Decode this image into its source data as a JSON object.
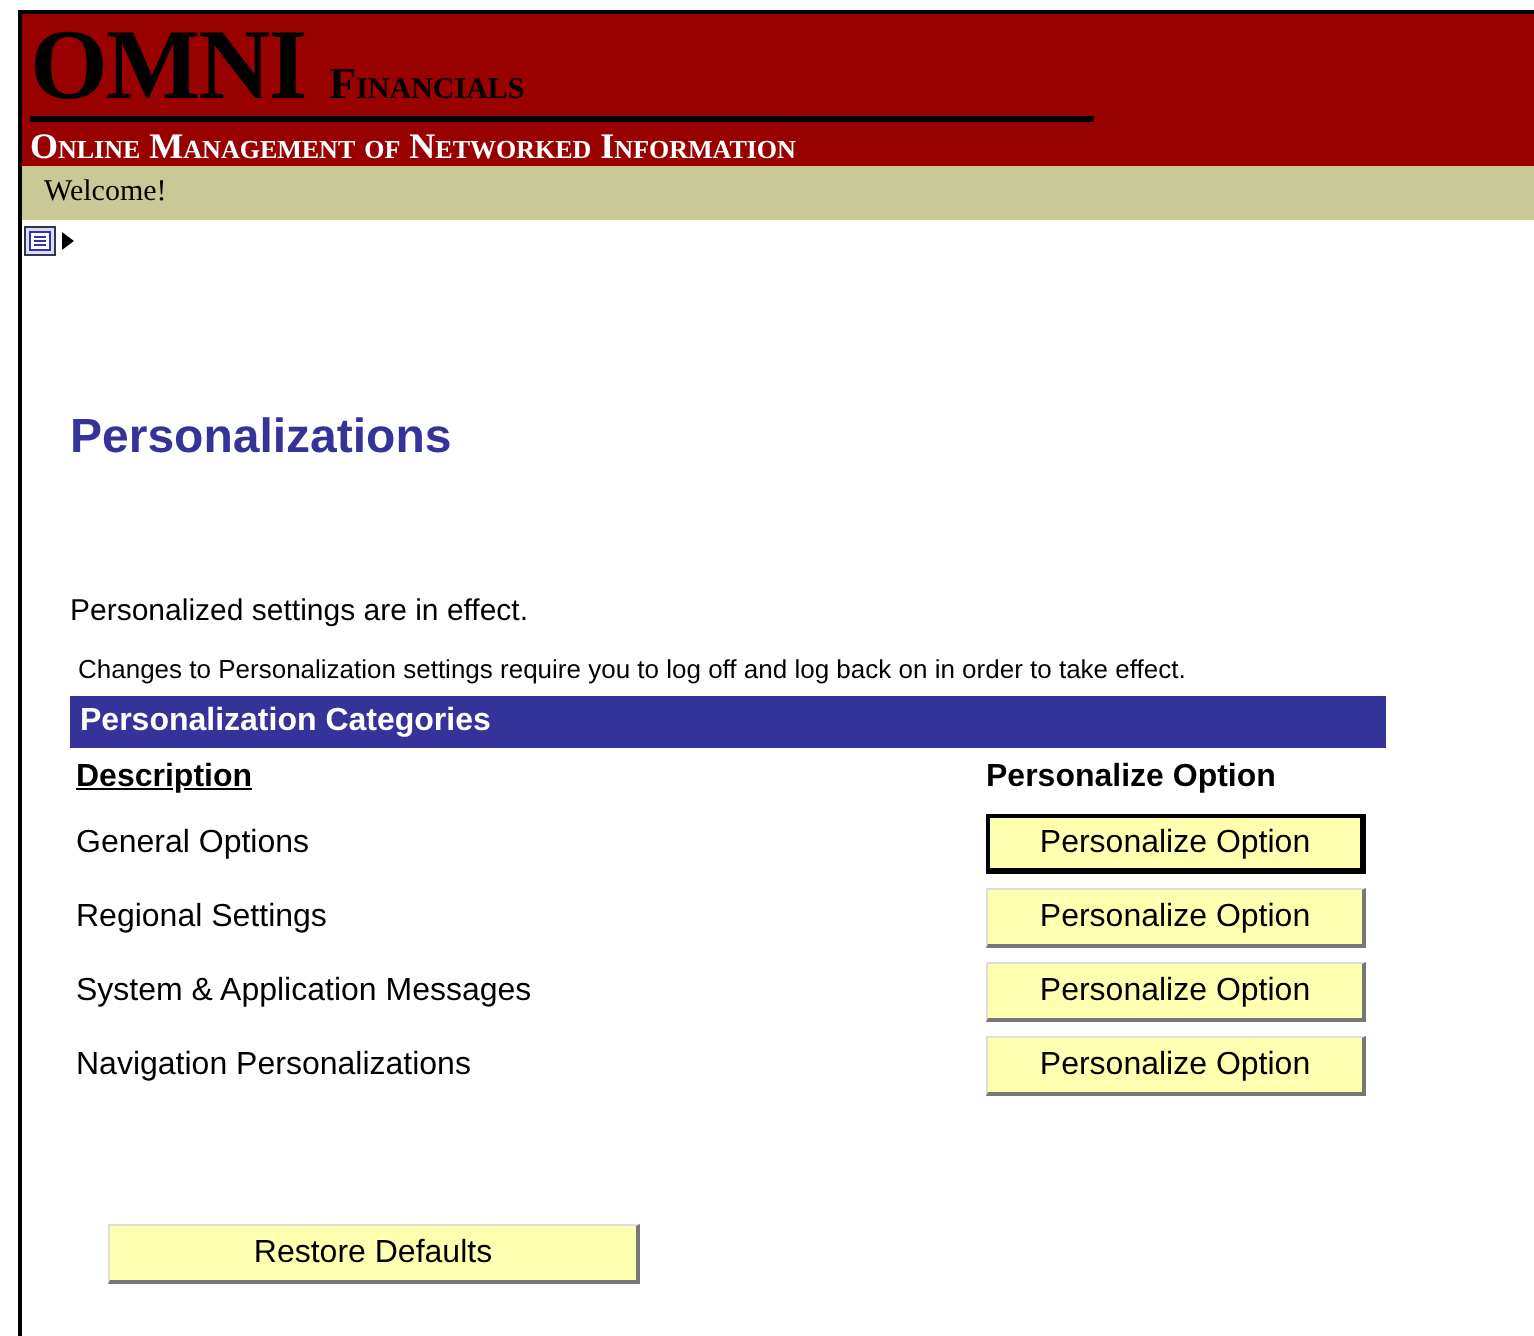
{
  "header": {
    "logo": "OMNI",
    "subtitle": "Financials",
    "tagline": "Online Management of Networked Information"
  },
  "welcome": "Welcome!",
  "page_title": "Personalizations",
  "status_message": "Personalized settings are in effect.",
  "notice": "Changes to Personalization settings require you to log off and log back on in order to take effect.",
  "table": {
    "title": "Personalization Categories",
    "columns": [
      "Description",
      "Personalize Option"
    ],
    "rows": [
      {
        "description": "General Options",
        "button": "Personalize Option",
        "focused": true
      },
      {
        "description": "Regional Settings",
        "button": "Personalize Option",
        "focused": false
      },
      {
        "description": "System & Application Messages",
        "button": "Personalize Option",
        "focused": false
      },
      {
        "description": "Navigation Personalizations",
        "button": "Personalize Option",
        "focused": false
      }
    ]
  },
  "restore_button": "Restore Defaults"
}
